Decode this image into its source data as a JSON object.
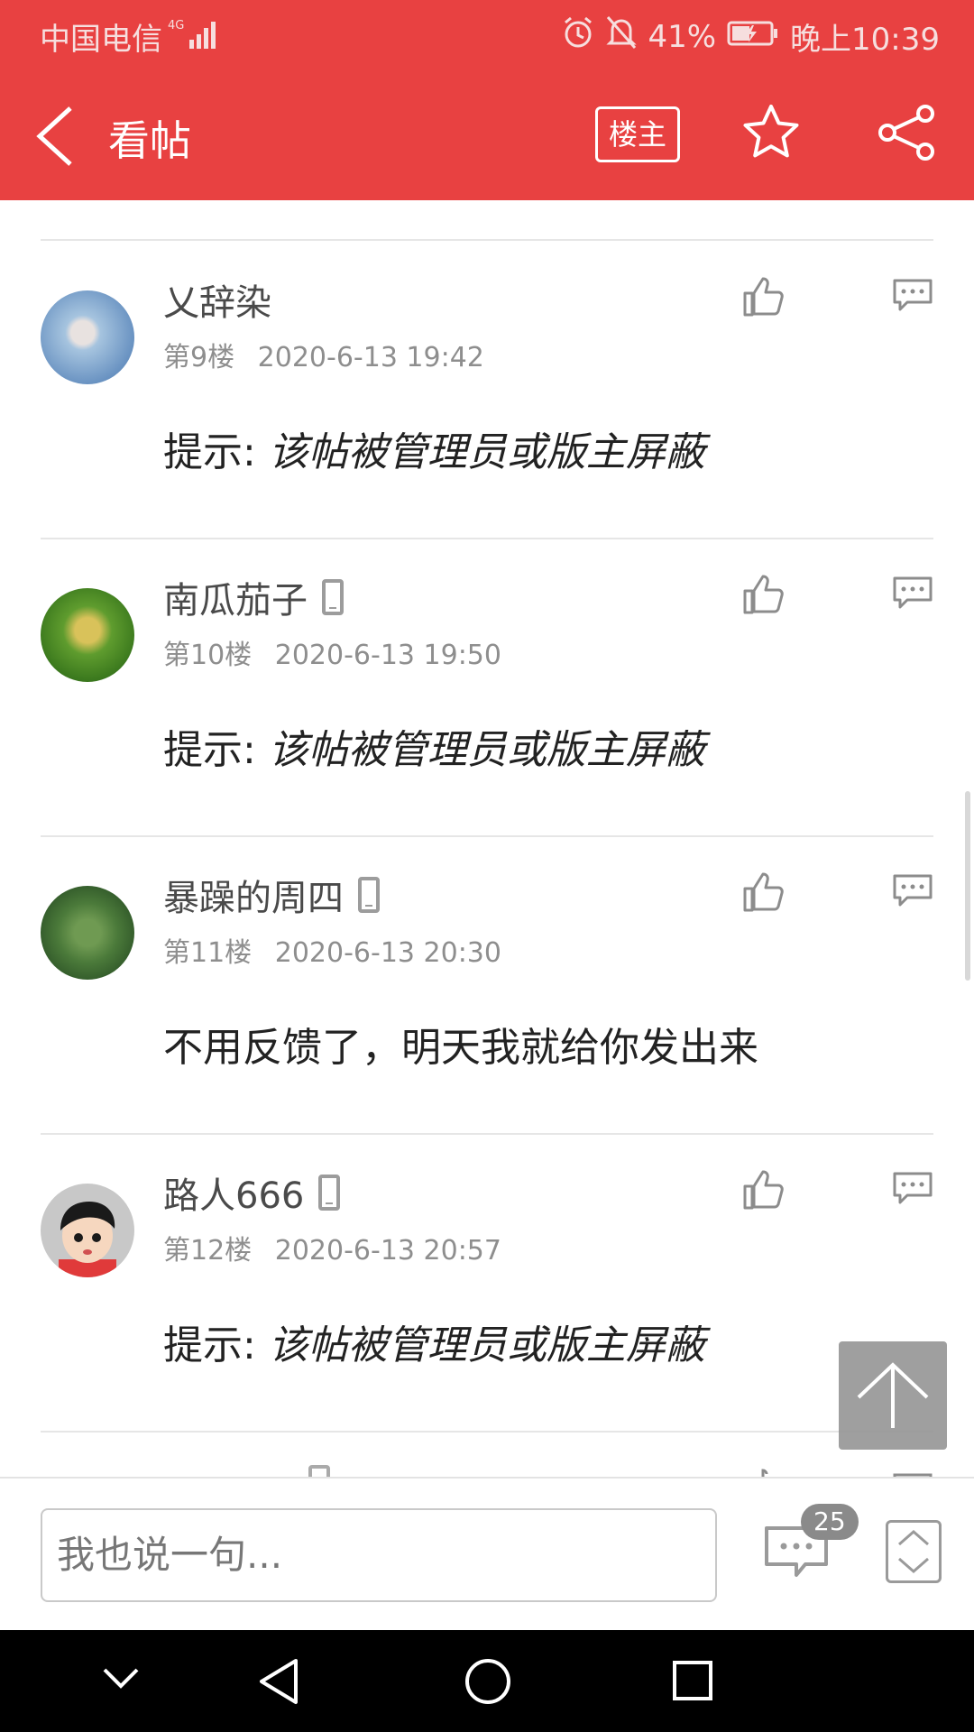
{
  "status_bar": {
    "carrier": "中国电信",
    "network": "4G",
    "battery": "41%",
    "time": "晚上10:39"
  },
  "header": {
    "title": "看帖",
    "op_button": "楼主"
  },
  "posts": [
    {
      "username": "乂辞染",
      "floor": "第9楼",
      "time": "2020-6-13 19:42",
      "hint_label": "提示:",
      "hint_text": "该帖被管理员或版主屏蔽",
      "device": false
    },
    {
      "username": "南瓜茄子",
      "floor": "第10楼",
      "time": "2020-6-13 19:50",
      "hint_label": "提示:",
      "hint_text": "该帖被管理员或版主屏蔽",
      "device": true
    },
    {
      "username": "暴躁的周四",
      "floor": "第11楼",
      "time": "2020-6-13 20:30",
      "body": "不用反馈了，明天我就给你发出来",
      "device": true
    },
    {
      "username": "路人666",
      "floor": "第12楼",
      "time": "2020-6-13 20:57",
      "hint_label": "提示:",
      "hint_text": "该帖被管理员或版主屏蔽",
      "device": true
    }
  ],
  "bottom_bar": {
    "input_placeholder": "我也说一句...",
    "comment_count": "25"
  },
  "colors": {
    "accent": "#e84141"
  }
}
